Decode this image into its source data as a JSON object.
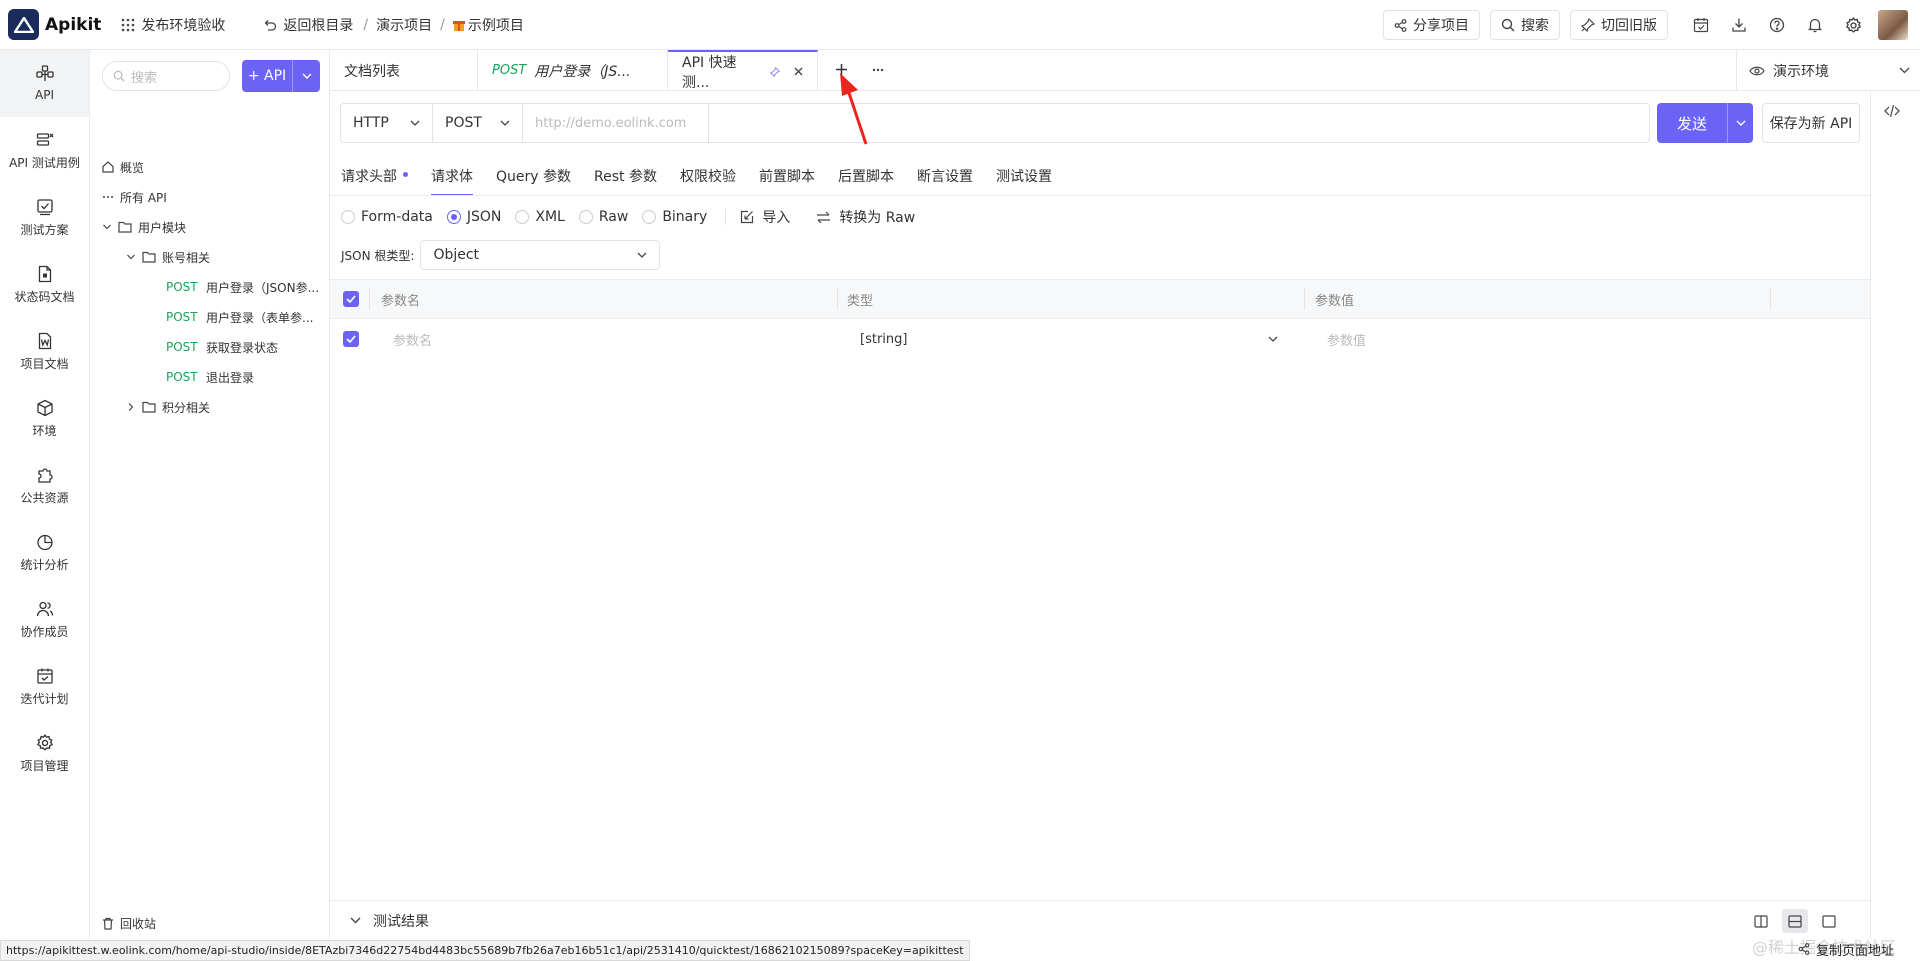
{
  "topbar": {
    "app_name": "Apikit",
    "workspace": "发布环境验收",
    "back_root": "返回根目录",
    "crumb_project": "演示项目",
    "crumb_sep": "/",
    "crumb_current": "示例项目",
    "share": "分享项目",
    "search": "搜索",
    "old_version": "切回旧版"
  },
  "rail": [
    {
      "label": "API",
      "icon": "api-icon"
    },
    {
      "label": "API 测试用例",
      "icon": "test-case-icon"
    },
    {
      "label": "测试方案",
      "icon": "test-plan-icon"
    },
    {
      "label": "状态码文档",
      "icon": "status-doc-icon"
    },
    {
      "label": "项目文档",
      "icon": "word-doc-icon"
    },
    {
      "label": "环境",
      "icon": "cube-icon"
    },
    {
      "label": "公共资源",
      "icon": "puzzle-icon"
    },
    {
      "label": "统计分析",
      "icon": "pie-chart-icon"
    },
    {
      "label": "协作成员",
      "icon": "members-icon"
    },
    {
      "label": "迭代计划",
      "icon": "calendar-icon"
    },
    {
      "label": "项目管理",
      "icon": "settings-icon"
    }
  ],
  "tree": {
    "search_placeholder": "搜索",
    "add_api": "+ API",
    "overview": "概览",
    "all_api": "所有 API",
    "group_user": "用户模块",
    "group_account": "账号相关",
    "apis": [
      {
        "method": "POST",
        "name": "用户登录（JSON参..."
      },
      {
        "method": "POST",
        "name": "用户登录（表单参..."
      },
      {
        "method": "POST",
        "name": "获取登录状态"
      },
      {
        "method": "POST",
        "name": "退出登录"
      }
    ],
    "group_points": "积分相关",
    "recycle": "回收站"
  },
  "tabs": {
    "doc_list": "文档列表",
    "tab1_method": "POST",
    "tab1_title": "用户登录（JS...",
    "tab2_title": "API 快速测...",
    "env": "演示环境"
  },
  "request": {
    "protocol": "HTTP",
    "method": "POST",
    "url_placeholder": "http://demo.eolink.com",
    "send": "发送",
    "save_as_api": "保存为新 API"
  },
  "req_tabs": [
    "请求头部",
    "请求体",
    "Query 参数",
    "Rest 参数",
    "权限校验",
    "前置脚本",
    "后置脚本",
    "断言设置",
    "测试设置"
  ],
  "body_types": [
    "Form-data",
    "JSON",
    "XML",
    "Raw",
    "Binary"
  ],
  "body_selected": "JSON",
  "actions": {
    "import": "导入",
    "to_raw": "转换为 Raw"
  },
  "root_type_label": "JSON 根类型:",
  "root_type_value": "Object",
  "table": {
    "headers": [
      "参数名",
      "类型",
      "参数值"
    ],
    "row": {
      "name_placeholder": "参数名",
      "type": "[string]",
      "value_placeholder": "参数值"
    }
  },
  "results": {
    "label": "测试结果"
  },
  "status_url": "https://apikittest.w.eolink.com/home/api-studio/inside/8ETAzbi7346d22754bd4483bc55689b7fb26a7eb16b51c1/api/2531410/quicktest/1686210215089?spaceKey=apikittest",
  "copy_url": "复制页面地址",
  "watermark": "@稀土掘金技术社区",
  "colors": {
    "accent": "#6b63f6",
    "post": "#1aa35a",
    "annotation_arrow": "#e8261e"
  }
}
